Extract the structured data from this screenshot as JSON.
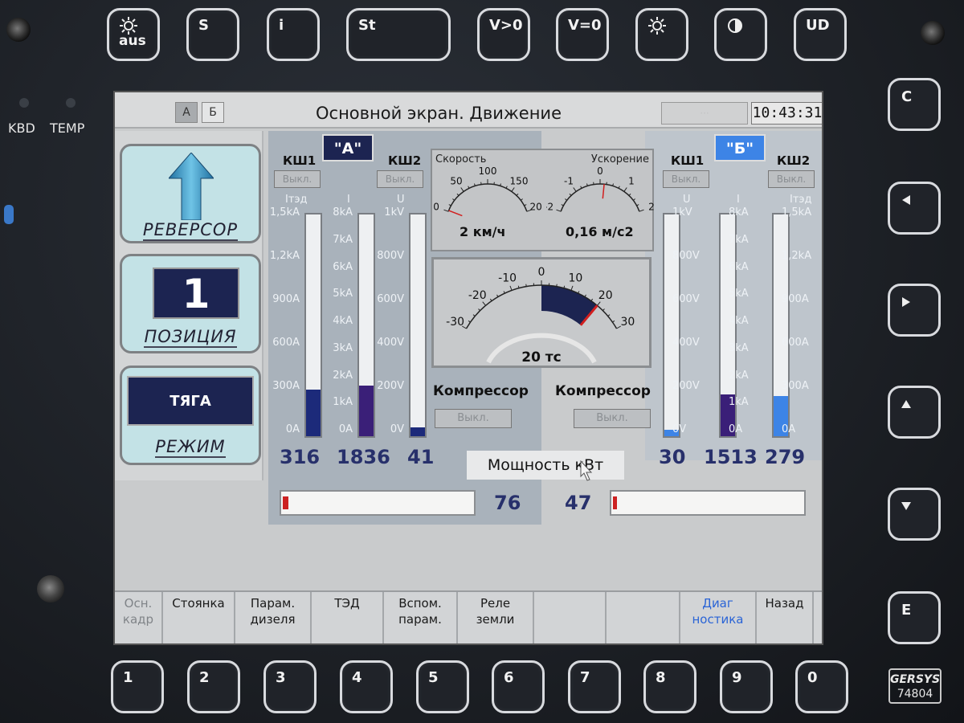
{
  "panel": {
    "led_labels": [
      "KBD",
      "TEMP"
    ],
    "brand_name": "GERSYS",
    "model_number": "74804",
    "top_keys": [
      {
        "label": "aus",
        "icon": "sun-icon"
      },
      {
        "label": "S"
      },
      {
        "label": "i"
      },
      {
        "label": "St"
      },
      {
        "label": "V>0"
      },
      {
        "label": "V=0"
      },
      {
        "label": "",
        "icon": "sun-icon"
      },
      {
        "label": "",
        "icon": "contrast-icon"
      },
      {
        "label": "UD"
      }
    ],
    "right_keys": [
      "C",
      "◀",
      "▶",
      "▲",
      "▼",
      "E"
    ],
    "bottom_keys": [
      "1",
      "2",
      "3",
      "4",
      "5",
      "6",
      "7",
      "8",
      "9",
      "0"
    ]
  },
  "screen": {
    "tabs": [
      "А",
      "Б"
    ],
    "title": "Основной экран. Движение",
    "time": "10:43:31",
    "left_panel": {
      "reverser_label": "РЕВЕРСОР",
      "position_value": "1",
      "position_label": "ПОЗИЦИЯ",
      "mode_value": "ТЯГА",
      "mode_label": "РЕЖИМ"
    },
    "side_a": {
      "badge": "\"А\"",
      "kw1_label": "КШ1",
      "kw2_label": "КШ2",
      "kw_button": "Выкл.",
      "columns": [
        {
          "header": "Iтэд",
          "ticks": [
            "1,5kA",
            "1,2kA",
            "900A",
            "600A",
            "300A",
            "0A"
          ],
          "value": "316",
          "fraction": 0.21,
          "color": "#1c2a7a"
        },
        {
          "header": "I",
          "ticks": [
            "8kA",
            "7kA",
            "6kA",
            "5kA",
            "4kA",
            "3kA",
            "2kA",
            "1kA",
            "0A"
          ],
          "value": "1836",
          "fraction": 0.23,
          "color": "#3a1f78"
        },
        {
          "header": "U",
          "ticks": [
            "1kV",
            "800V",
            "600V",
            "400V",
            "200V",
            "0V"
          ],
          "value": "41",
          "fraction": 0.04,
          "color": "#1c2a7a"
        }
      ],
      "power_value": "76",
      "power_fraction": 0.03
    },
    "side_b": {
      "badge": "\"Б\"",
      "kw1_label": "КШ1",
      "kw2_label": "КШ2",
      "kw_button": "Выкл.",
      "columns": [
        {
          "header": "U",
          "ticks": [
            "1kV",
            "800V",
            "600V",
            "400V",
            "200V",
            "0V"
          ],
          "value": "30",
          "fraction": 0.03,
          "color": "#3d84e6"
        },
        {
          "header": "I",
          "ticks": [
            "8kA",
            "7kA",
            "6kA",
            "5kA",
            "4kA",
            "3kA",
            "2kA",
            "1kA",
            "0A"
          ],
          "value": "1513",
          "fraction": 0.19,
          "color": "#3a1f78"
        },
        {
          "header": "Iтэд",
          "ticks": [
            "1,5kA",
            "1,2kA",
            "900A",
            "600A",
            "300A",
            "0A"
          ],
          "value": "279",
          "fraction": 0.18,
          "color": "#3d84e6"
        }
      ],
      "power_value": "47",
      "power_fraction": 0.02
    },
    "speed": {
      "title": "Скорость",
      "ticks": [
        "0",
        "50",
        "100",
        "150",
        "200"
      ],
      "value": 2,
      "readout": "2 км/ч"
    },
    "accel": {
      "title": "Ускорение",
      "ticks": [
        "-2",
        "-1",
        "0",
        "1",
        "2"
      ],
      "value": 0.16,
      "readout": "0,16 м/с2"
    },
    "force": {
      "ticks": [
        "-30",
        "-20",
        "-10",
        "0",
        "10",
        "20",
        "30"
      ],
      "value": 20,
      "readout": "20 тс"
    },
    "compressor_label": "Компрессор",
    "compressor_button": "Выкл.",
    "power_title": "Мощность кВт",
    "softkeys": [
      {
        "l1": "Осн.",
        "l2": "кадр",
        "style": "dim"
      },
      {
        "l1": "Стоянка",
        "l2": "",
        "style": ""
      },
      {
        "l1": "Парам.",
        "l2": "дизеля",
        "style": ""
      },
      {
        "l1": "ТЭД",
        "l2": "",
        "style": ""
      },
      {
        "l1": "Вспом.",
        "l2": "парам.",
        "style": ""
      },
      {
        "l1": "Реле",
        "l2": "земли",
        "style": ""
      },
      {
        "l1": "",
        "l2": "",
        "style": ""
      },
      {
        "l1": "",
        "l2": "",
        "style": ""
      },
      {
        "l1": "Диаг",
        "l2": "ностика",
        "style": "blue"
      },
      {
        "l1": "Назад",
        "l2": "",
        "style": ""
      }
    ]
  }
}
